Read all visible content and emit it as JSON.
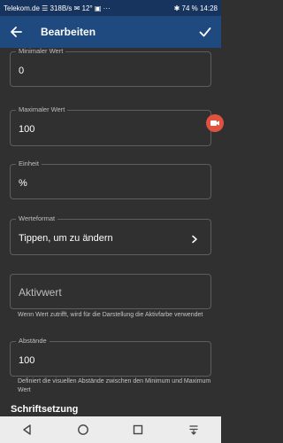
{
  "status_bar": {
    "left_text": "Telekom.de ☰ 318B/s ✉ 12° ▣ ···",
    "right_text": "✱ 74 % 14:28"
  },
  "app_bar": {
    "title": "Bearbeiten"
  },
  "fields": {
    "min": {
      "label": "Minimaler Wert",
      "value": "0"
    },
    "max": {
      "label": "Maximaler Wert",
      "value": "100"
    },
    "unit": {
      "label": "Einheit",
      "value": "%"
    },
    "format": {
      "label": "Werteformat",
      "value": "Tippen, um zu ändern"
    },
    "active": {
      "placeholder": "Aktivwert"
    },
    "spacing": {
      "label": "Abstände",
      "value": "100"
    }
  },
  "helpers": {
    "active": "Wenn Wert zutrifft, wird für die Darstellung die Aktivfarbe verwendet",
    "spacing": "Definiert die visuellen Abstände zwischen den Minimum und Maximum Wert"
  },
  "section_title": "Schriftsetzung",
  "colors": {
    "app_bar": "#1f4a7f",
    "status_bar": "#16345e",
    "background": "#303030",
    "badge": "#e0523e"
  },
  "icons": [
    "back-arrow-icon",
    "check-icon",
    "chevron-right-icon",
    "video-record-icon",
    "nav-back-icon",
    "nav-home-icon",
    "nav-recents-icon",
    "nav-menu-icon"
  ]
}
